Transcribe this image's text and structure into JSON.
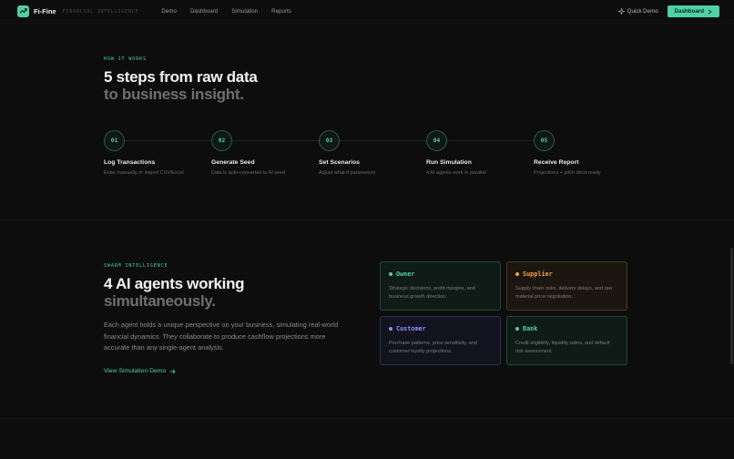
{
  "nav": {
    "brand": "Fi-Fine",
    "tagline": "FINANCIAL INTELLIGENCE",
    "links": [
      "Demo",
      "Dashboard",
      "Simulation",
      "Reports"
    ],
    "quick_demo": "Quick Demo",
    "dashboard_btn": "Dashboard"
  },
  "how": {
    "eyebrow": "HOW IT WORKS",
    "title_line1": "5 steps from raw data",
    "title_line2": "to business insight.",
    "steps": [
      {
        "num": "01",
        "title": "Log Transactions",
        "desc": "Enter manually or import CSV/Excel"
      },
      {
        "num": "02",
        "title": "Generate Seed",
        "desc": "Data is auto-converted to AI seed"
      },
      {
        "num": "03",
        "title": "Set Scenarios",
        "desc": "Adjust what-if parameters"
      },
      {
        "num": "04",
        "title": "Run Simulation",
        "desc": "4 AI agents work in parallel"
      },
      {
        "num": "05",
        "title": "Receive Report",
        "desc": "Projections + pitch deck ready"
      }
    ]
  },
  "swarm": {
    "eyebrow": "SWARM INTELLIGENCE",
    "title_line1": "4 AI agents working",
    "title_line2": "simultaneously.",
    "paragraph": "Each agent holds a unique perspective on your business, simulating real-world financial dynamics. They collaborate to produce cashflow projections more accurate than any single-agent analysis.",
    "link": "View Simulation Demo",
    "agents": [
      {
        "name": "Owner",
        "desc": "Strategic decisions, profit margins, and business growth direction.",
        "color": "#4fd1a3"
      },
      {
        "name": "Supplier",
        "desc": "Supply chain risks, delivery delays, and raw material price negotiation.",
        "color": "#f0a54a"
      },
      {
        "name": "Customer",
        "desc": "Purchase patterns, price sensitivity, and customer loyalty projections.",
        "color": "#8b93ff"
      },
      {
        "name": "Bank",
        "desc": "Credit eligibility, liquidity ratios, and default risk assessment.",
        "color": "#4fd1a3"
      }
    ]
  }
}
